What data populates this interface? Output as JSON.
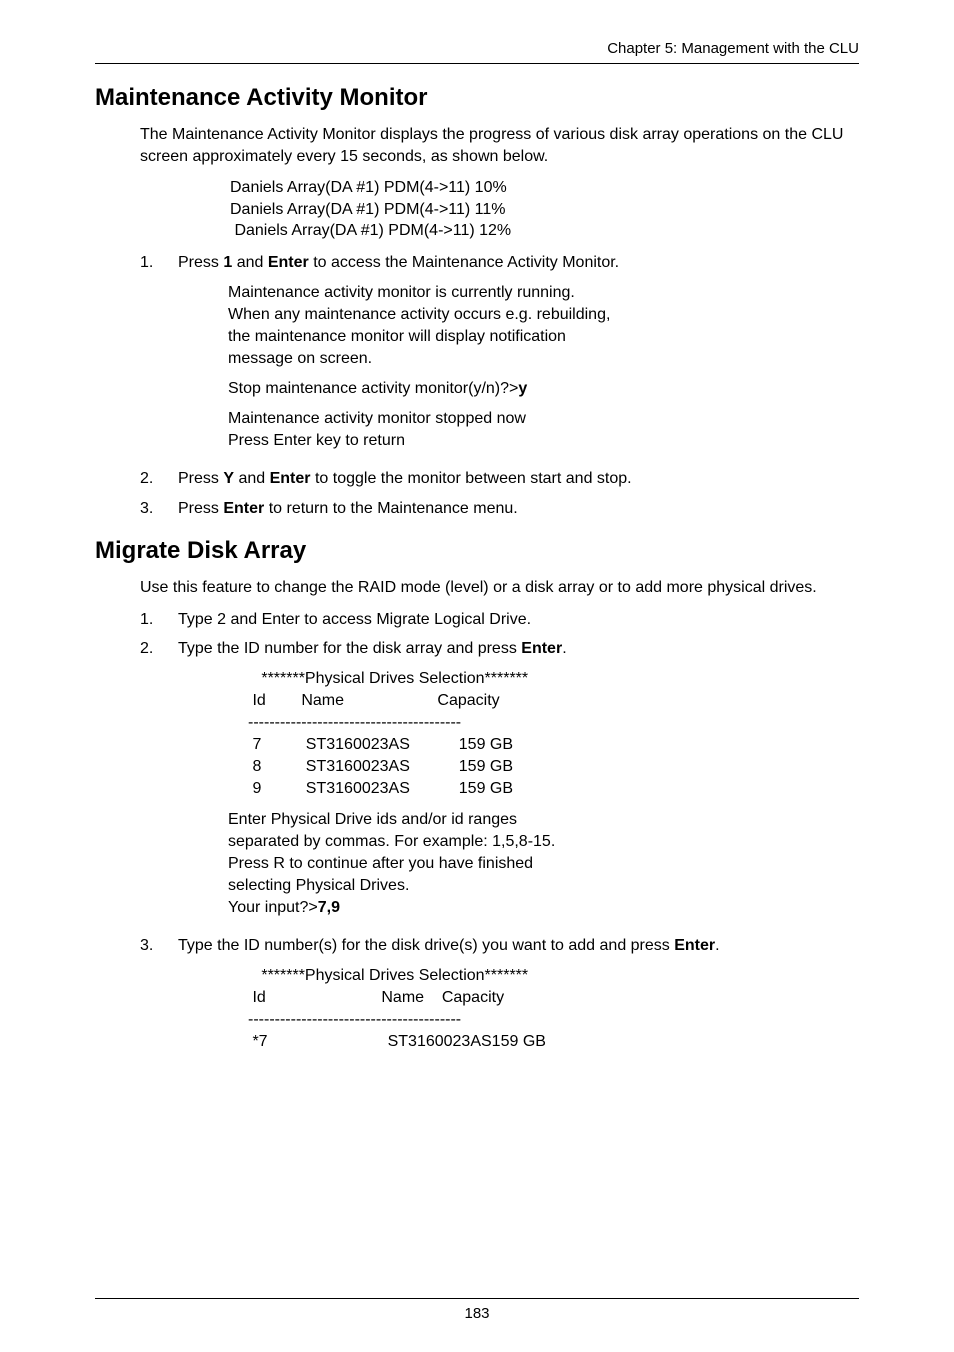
{
  "header": {
    "chapter": "Chapter 5: Management with the CLU"
  },
  "section1": {
    "title": "Maintenance Activity Monitor",
    "intro": "The Maintenance Activity Monitor displays the progress of various disk array operations on the CLU screen approximately every 15 seconds, as shown below.",
    "sample": {
      "l1": "Daniels Array(DA #1) PDM(4->11) 10%",
      "l2": "Daniels Array(DA #1) PDM(4->11) 11%",
      "l3": " Daniels Array(DA #1) PDM(4->11) 12%"
    },
    "step1": {
      "num": "1.",
      "pre": "Press ",
      "b1": "1",
      "mid": " and ",
      "b2": "Enter",
      "post": " to access the Maintenance Activity Monitor."
    },
    "s1block1": {
      "l1": "Maintenance activity monitor is currently running.",
      "l2": "When any maintenance activity occurs e.g. rebuilding,",
      "l3": "the maintenance monitor will display notification",
      "l4": "message on screen."
    },
    "s1block2": {
      "l1": "Stop maintenance activity monitor(y/n)?>",
      "bold": "y"
    },
    "s1block3": {
      "l1": "Maintenance activity monitor stopped now",
      "l2": "Press Enter key to return"
    },
    "step2": {
      "num": "2.",
      "pre": "Press ",
      "b1": "Y",
      "mid": " and ",
      "b2": "Enter",
      "post": " to toggle the monitor between start and stop."
    },
    "step3": {
      "num": "3.",
      "pre": "Press ",
      "b1": "Enter",
      "post": " to return to the Maintenance menu."
    }
  },
  "section2": {
    "title": "Migrate Disk Array",
    "intro": "Use this feature to change the RAID mode (level) or a disk array or to add more physical drives.",
    "step1": {
      "num": "1.",
      "text": "Type 2 and Enter to access Migrate Logical Drive."
    },
    "step2": {
      "num": "2.",
      "pre": "Type the ID number for the disk array and press ",
      "b1": "Enter",
      "post": "."
    },
    "s2block1": {
      "title": "   *******Physical Drives Selection*******",
      "hdr": " Id        Name                     Capacity",
      "sep": "----------------------------------------",
      "r1": " 7          ST3160023AS           159 GB",
      "r2": " 8          ST3160023AS           159 GB",
      "r3": " 9          ST3160023AS           159 GB"
    },
    "s2block2": {
      "l1": "Enter Physical Drive ids and/or id ranges",
      "l2": "separated by commas. For example: 1,5,8-15.",
      "l3": "Press R to continue after you have finished",
      "l4": "selecting Physical Drives.",
      "l5": "Your input?>",
      "bold": "7,9"
    },
    "step3": {
      "num": "3.",
      "pre": "Type the ID number(s) for the disk drive(s) you want to add and press ",
      "b1": "Enter",
      "post": "."
    },
    "s3block1": {
      "title": "   *******Physical Drives Selection*******",
      "hdr": " Id                          Name    Capacity",
      "sep": "----------------------------------------",
      "r1": " *7                           ST3160023AS159 GB"
    }
  },
  "footer": {
    "page": "183"
  }
}
